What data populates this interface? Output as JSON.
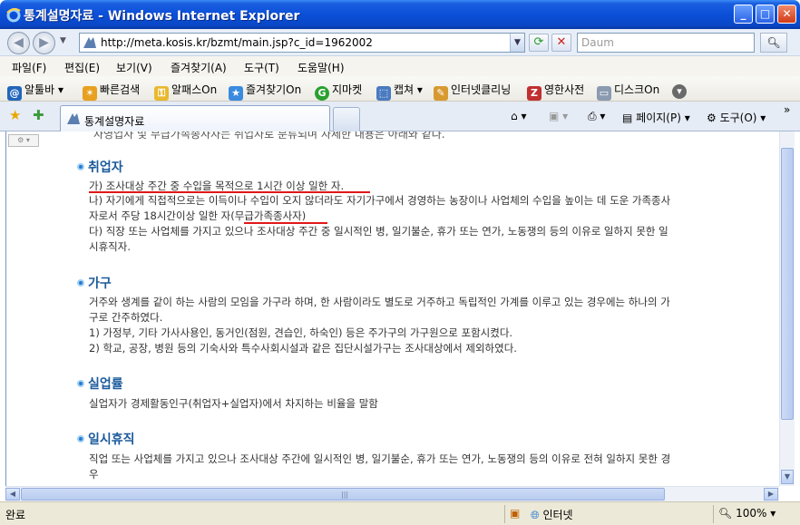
{
  "window": {
    "title": "통계설명자료 - Windows Internet Explorer",
    "controls": {
      "minimize": "_",
      "maximize": "□",
      "close": "✕"
    }
  },
  "address": {
    "url": "http://meta.kosis.kr/bzmt/main.jsp?c_id=1962002",
    "search_placeholder": "Daum"
  },
  "menu": [
    "파일(F)",
    "편집(E)",
    "보기(V)",
    "즐겨찾기(A)",
    "도구(T)",
    "도움말(H)"
  ],
  "links_toolbar": [
    "알툴바",
    "빠른검색",
    "알패스On",
    "즐겨찾기On",
    "지마켓",
    "캡쳐",
    "인터넷클리닝",
    "영한사전",
    "디스크On"
  ],
  "tab": {
    "title": "통계설명자료",
    "commands": {
      "page": "페이지(P)",
      "tools": "도구(O)"
    }
  },
  "content": {
    "cut_line": "자영업자 및 무급가족종사자는 취업자로 분류되며 자세한 내용은 아래와 같다.",
    "sections": [
      {
        "title": "취업자",
        "lines": [
          "가) 조사대상 주간 중 수입을 목적으로 1시간 이상 일한 자.",
          "나) 자기에게 직접적으로는 이득이나 수입이 오지 않더라도 자기가구에서 경영하는 농장이나 사업체의 수입을 높이는 데 도운 가족종사",
          "자로서 주당 18시간이상 일한 자(무급가족종사자)",
          "다) 직장 또는 사업체를 가지고 있으나 조사대상 주간 중 일시적인 병, 일기불순, 휴가 또는 연가, 노동쟁의 등의 이유로 일하지 못한 일",
          "시휴직자."
        ]
      },
      {
        "title": "가구",
        "lines": [
          "거주와 생계를 같이 하는 사람의 모임을 가구라 하며, 한 사람이라도 별도로 거주하고 독립적인 가계를 이루고 있는 경우에는 하나의 가",
          "구로 간주하였다.",
          "1) 가정부, 기타 가사사용인, 동거인(점원, 견습인, 하숙인) 등은 주가구의 가구원으로 포함시켰다.",
          "2) 학교, 공장, 병원 등의 기숙사와 특수사회시설과 같은 집단시설가구는 조사대상에서 제외하였다."
        ]
      },
      {
        "title": "실업률",
        "lines": [
          "실업자가 경제활동인구(취업자+실업자)에서 차지하는 비율을 말함"
        ]
      },
      {
        "title": "일시휴직",
        "lines": [
          "직업 또는 사업체를 가지고 있으나 조사대상 주간에 일시적인 병, 일기불순, 휴가 또는 연가, 노동쟁의 등의 이유로 전혀 일하지 못한 경",
          "우"
        ]
      }
    ]
  },
  "status": {
    "text": "완료",
    "zone": "인터넷",
    "zoom": "100%"
  },
  "colors": {
    "titlebar": "#0b4fd8",
    "section_title": "#1b5a9c",
    "underline": "#e01818"
  }
}
